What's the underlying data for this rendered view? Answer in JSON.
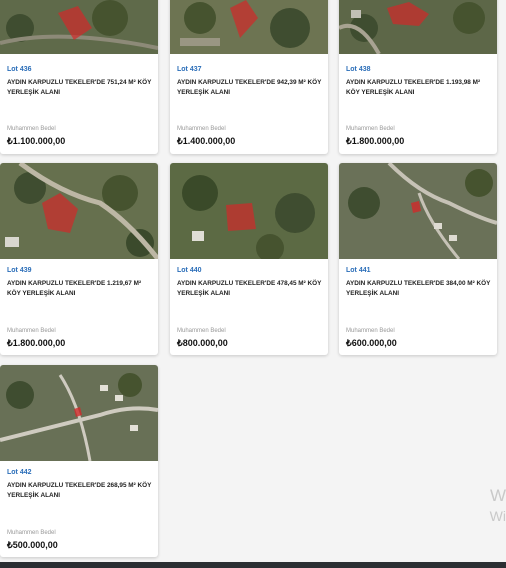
{
  "colors": {
    "lot_link": "#2a6db8",
    "marker": "#d12a2a"
  },
  "cards": [
    {
      "lot": "Lot 436",
      "title": "AYDIN KARPUZLU TEKELER'DE 751,24 M² KÖY YERLEŞİK ALANI",
      "bedel_label": "Muhammen Bedel",
      "price": "₺1.100.000,00"
    },
    {
      "lot": "Lot 437",
      "title": "AYDIN KARPUZLU TEKELER'DE 942,39 M² KÖY YERLEŞİK ALANI",
      "bedel_label": "Muhammen Bedel",
      "price": "₺1.400.000,00"
    },
    {
      "lot": "Lot 438",
      "title": "AYDIN KARPUZLU TEKELER'DE 1.193,98 M² KÖY YERLEŞİK ALANI",
      "bedel_label": "Muhammen Bedel",
      "price": "₺1.800.000,00"
    },
    {
      "lot": "Lot 439",
      "title": "AYDIN KARPUZLU TEKELER'DE 1.219,67 M² KÖY YERLEŞİK ALANI",
      "bedel_label": "Muhammen Bedel",
      "price": "₺1.800.000,00"
    },
    {
      "lot": "Lot 440",
      "title": "AYDIN KARPUZLU TEKELER'DE 478,45 M² KÖY YERLEŞİK ALANI",
      "bedel_label": "Muhammen Bedel",
      "price": "₺800.000,00"
    },
    {
      "lot": "Lot 441",
      "title": "AYDIN KARPUZLU TEKELER'DE 384,00 M² KÖY YERLEŞİK ALANI",
      "bedel_label": "Muhammen Bedel",
      "price": "₺600.000,00"
    },
    {
      "lot": "Lot 442",
      "title": "AYDIN KARPUZLU TEKELER'DE 268,95 M² KÖY YERLEŞİK ALANI",
      "bedel_label": "Muhammen Bedel",
      "price": "₺500.000,00"
    }
  ],
  "watermark": {
    "line1": "W",
    "line2": "Wi"
  }
}
